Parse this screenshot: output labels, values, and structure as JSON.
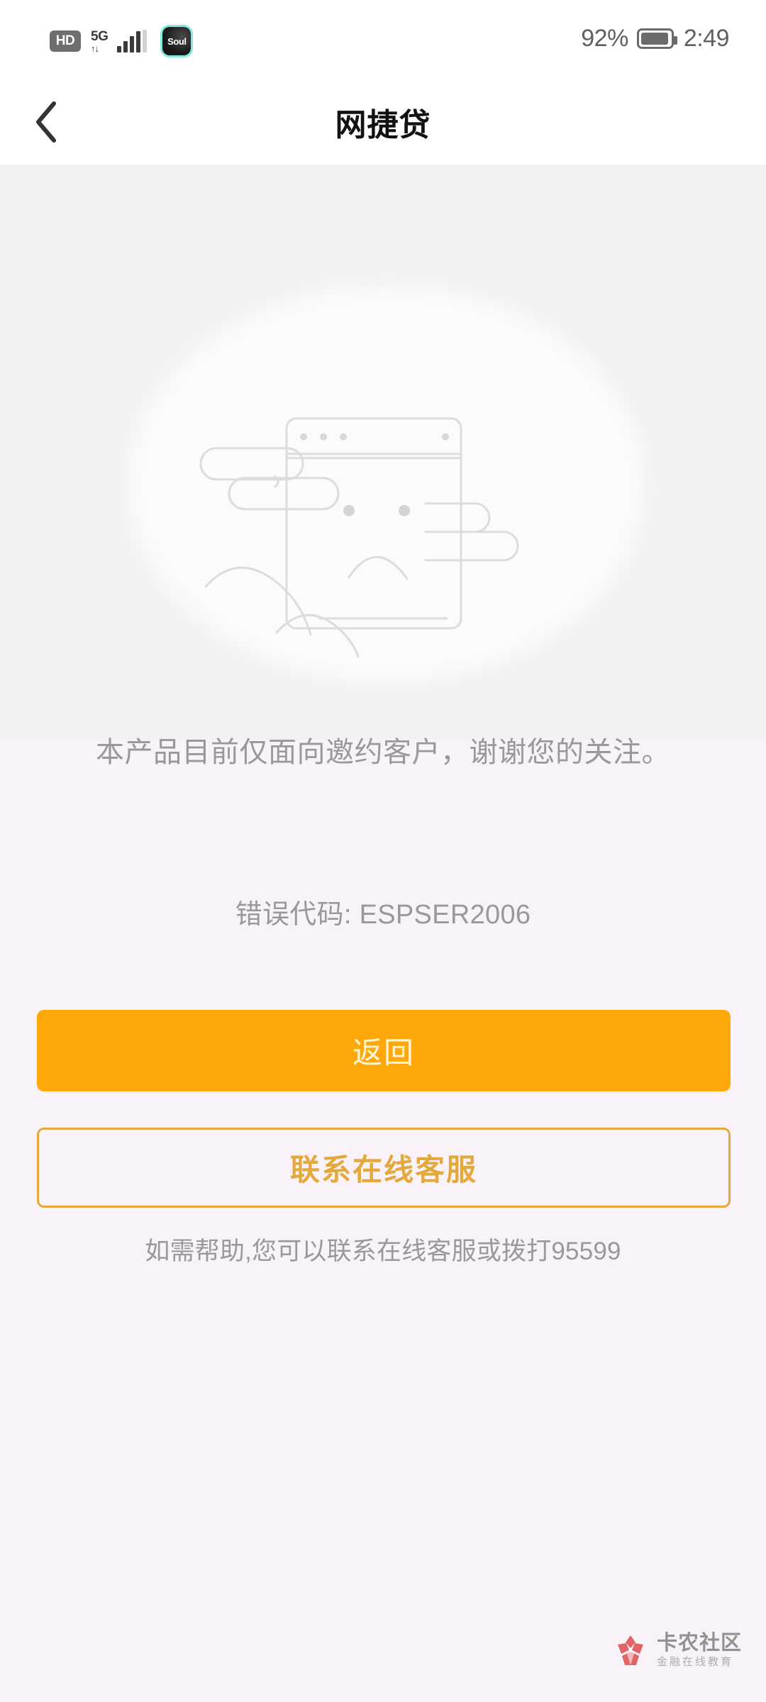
{
  "status_bar": {
    "hd_label": "HD",
    "network_label": "5G",
    "network_arrows": "↑↓",
    "app_icon_label": "Soul",
    "battery_percent": "92%",
    "time": "2:49"
  },
  "nav": {
    "back_icon": "chevron-left-icon",
    "title": "网捷贷"
  },
  "illustration": {
    "name": "sad-browser-window-illustration",
    "stroke_color": "#dcdcdc"
  },
  "main": {
    "message": "本产品目前仅面向邀约客户，谢谢您的关注。",
    "error_code": "错误代码: ESPSER2006",
    "primary_button": "返回",
    "secondary_button": "联系在线客服",
    "help_text": "如需帮助,您可以联系在线客服或拨打95599"
  },
  "watermark": {
    "title": "卡农社区",
    "subtitle": "金融在线教育"
  },
  "colors": {
    "primary_orange": "#ffa80a",
    "outline_gold": "#e3a93b",
    "text_gray": "#9b979e",
    "bg_top": "#f2f2f2",
    "bg_bottom": "#f9f2f9"
  }
}
